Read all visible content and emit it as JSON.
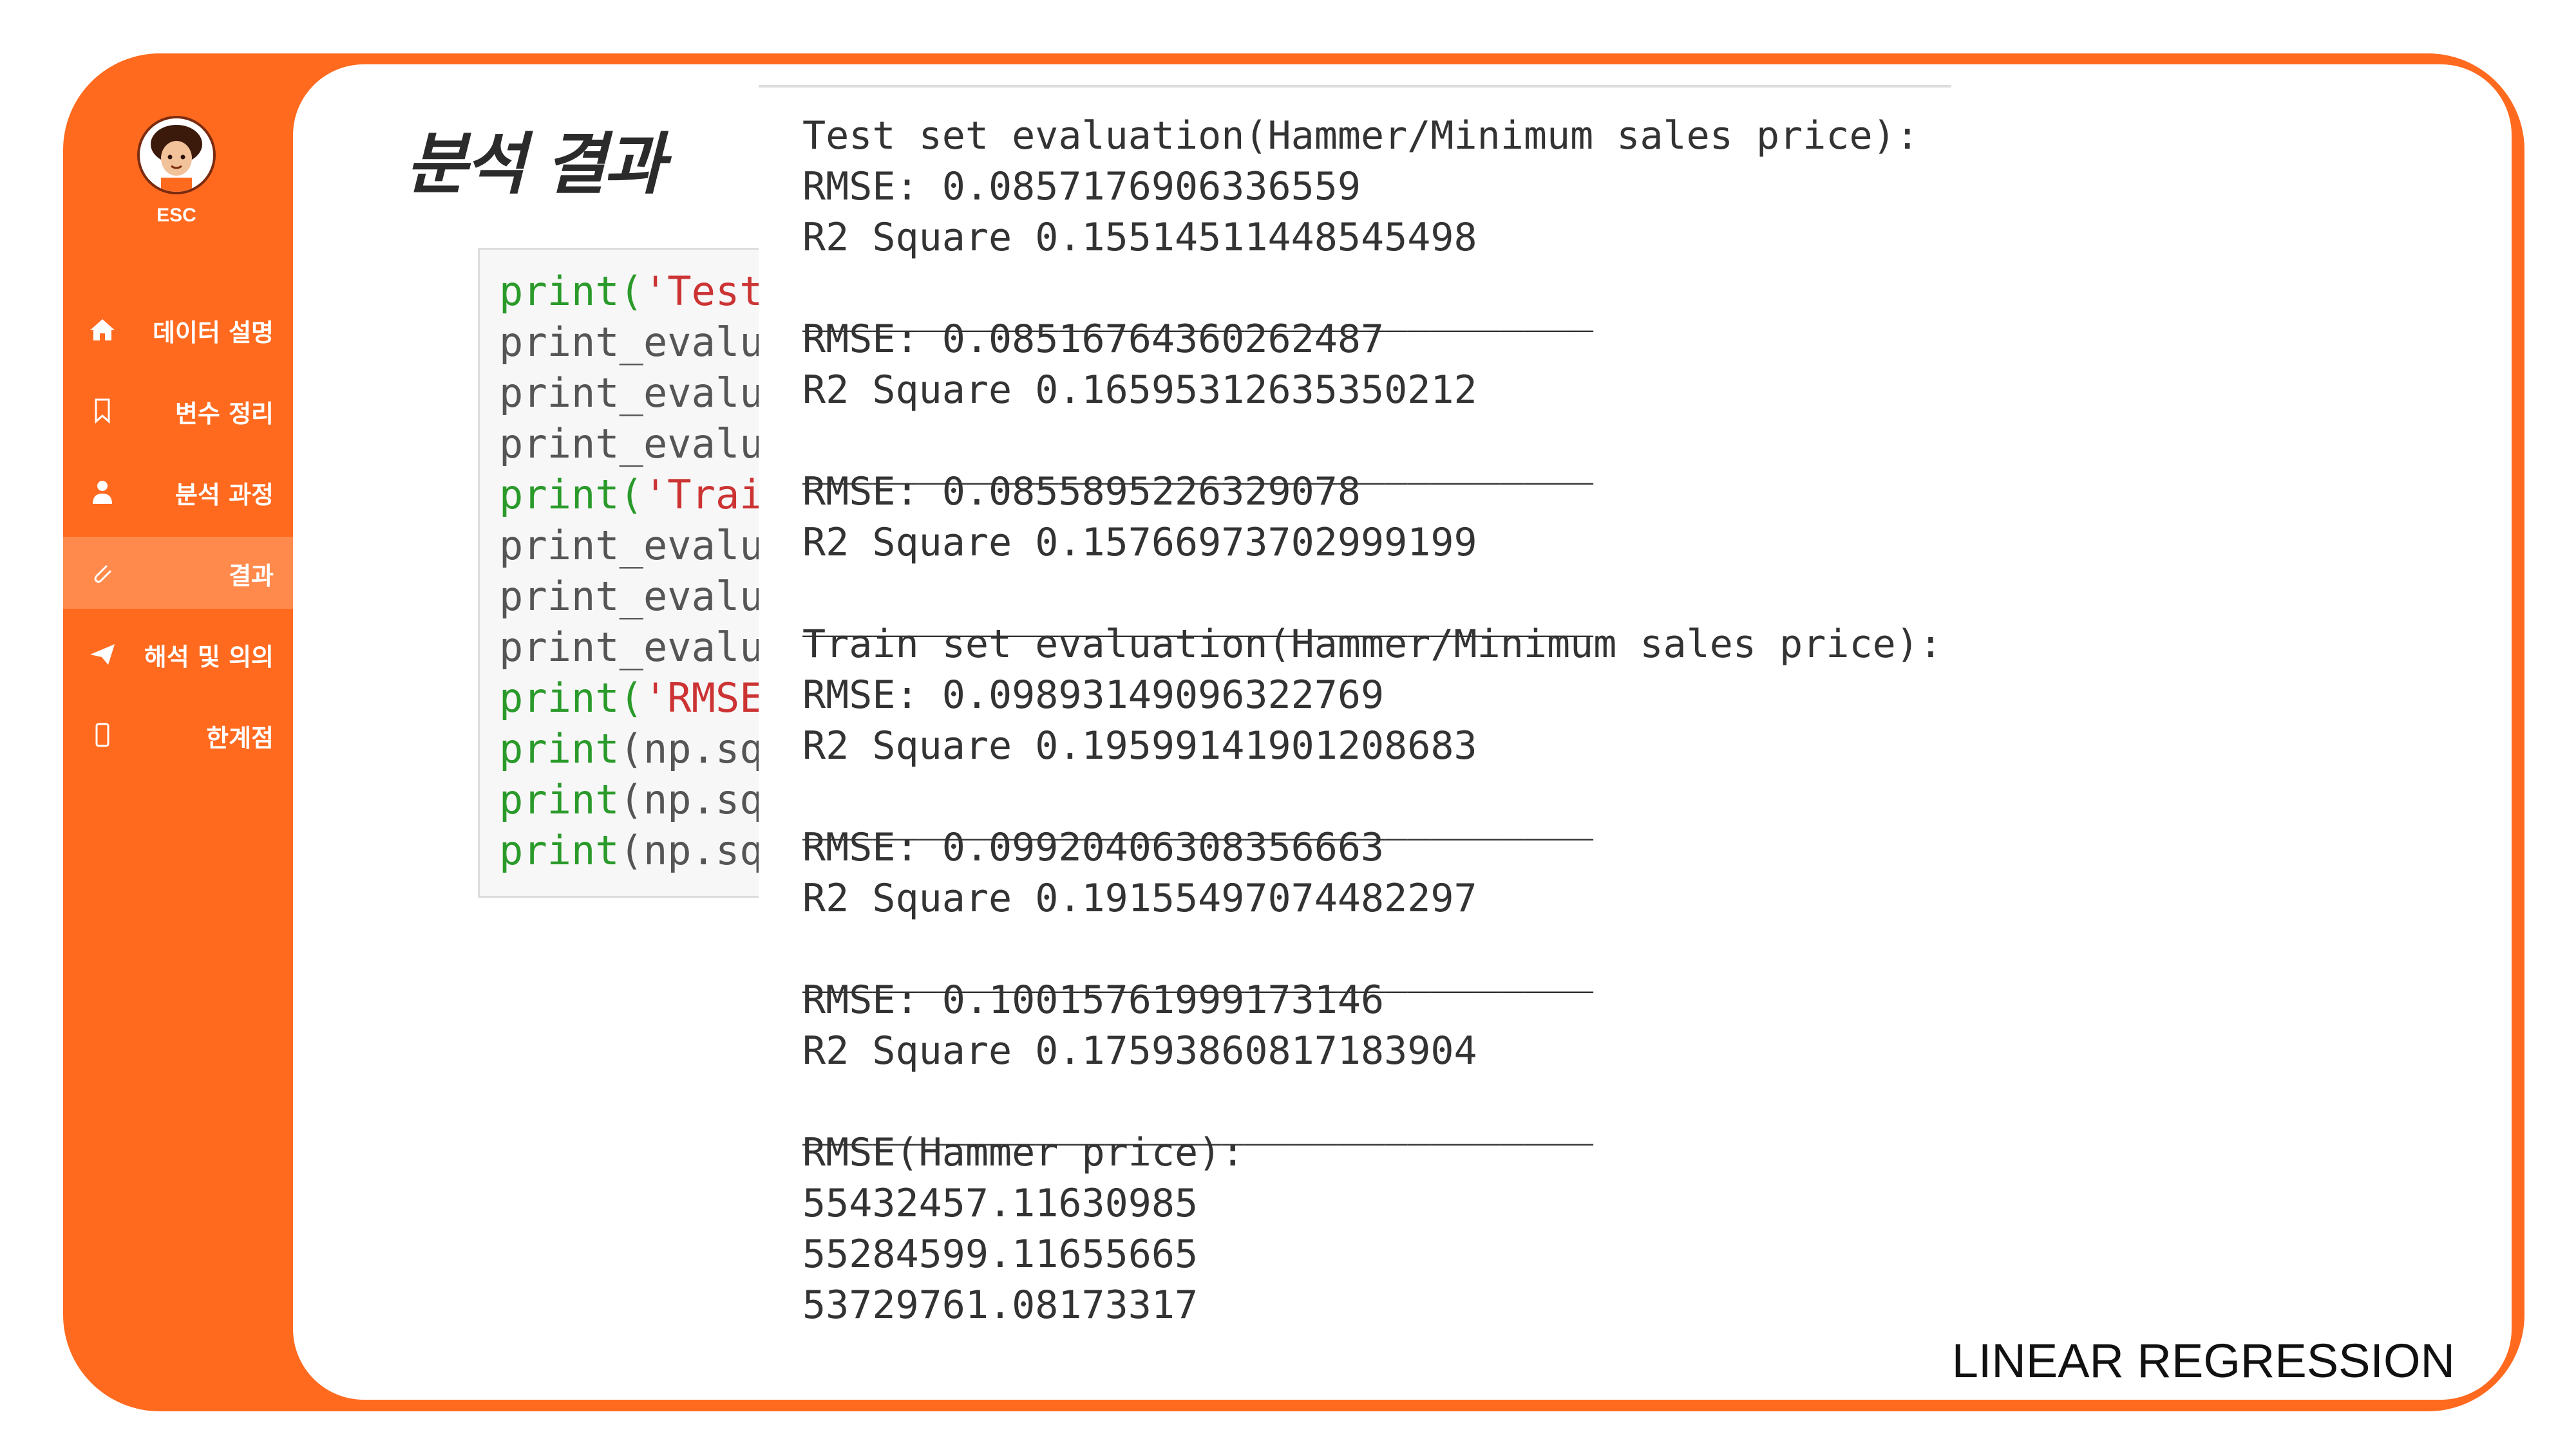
{
  "app": {
    "esc_label": "ESC"
  },
  "sidebar": {
    "items": [
      {
        "label": "데이터 설명",
        "icon": "home-icon",
        "active": false
      },
      {
        "label": "변수 정리",
        "icon": "bookmark-icon",
        "active": false
      },
      {
        "label": "분석 과정",
        "icon": "user-icon",
        "active": false
      },
      {
        "label": "결과",
        "icon": "paperclip-icon",
        "active": true
      },
      {
        "label": "해석 및 의의",
        "icon": "paper-plane-icon",
        "active": false
      },
      {
        "label": "한계점",
        "icon": "mobile-icon",
        "active": false
      }
    ]
  },
  "main": {
    "title": "분석 결과"
  },
  "code": {
    "lines": [
      {
        "fn": "print(",
        "rest": "'Test",
        "rest_type": "str"
      },
      {
        "fn": "",
        "rest": "print_evalua",
        "rest_type": "plain"
      },
      {
        "fn": "",
        "rest": "print_evalua",
        "rest_type": "plain"
      },
      {
        "fn": "",
        "rest": "print_evalua",
        "rest_type": "plain"
      },
      {
        "fn": "print(",
        "rest": "'Trair",
        "rest_type": "str"
      },
      {
        "fn": "",
        "rest": "print_evalua",
        "rest_type": "plain"
      },
      {
        "fn": "",
        "rest": "print_evalua",
        "rest_type": "plain"
      },
      {
        "fn": "",
        "rest": "print_evalua",
        "rest_type": "plain"
      },
      {
        "fn": "print(",
        "rest": "'RMSE(",
        "rest_type": "str"
      },
      {
        "fn": "print",
        "rest": "(np.sqr",
        "rest_type": "plain"
      },
      {
        "fn": "print",
        "rest": "(np.sqr",
        "rest_type": "plain"
      },
      {
        "fn": "print",
        "rest": "(np.sqr",
        "rest_type": "plain"
      }
    ]
  },
  "output": {
    "lines": [
      "Test set evaluation(Hammer/Minimum sales price):",
      "RMSE: 0.0857176906336559",
      "R2 Square 0.15514511448545498",
      "",
      "__________________________________",
      "RMSE: 0.08516764360262487",
      "R2 Square 0.16595312635350212",
      "",
      "__________________________________",
      "RMSE: 0.0855895226329078",
      "R2 Square 0.15766973702999199",
      "",
      "__________________________________",
      "Train set evaluation(Hammer/Minimum sales price):",
      "RMSE: 0.09893149096322769",
      "R2 Square 0.19599141901208683",
      "",
      "__________________________________",
      "RMSE: 0.09920406308356663",
      "R2 Square 0.19155497074482297",
      "",
      "__________________________________",
      "RMSE: 0.10015761999173146",
      "R2 Square 0.17593860817183904",
      "",
      "__________________________________",
      "RMSE(Hammer price):",
      "55432457.11630985",
      "55284599.11655665",
      "53729761.08173317"
    ]
  },
  "footer": {
    "text": "LINEAR REGRESSION"
  },
  "colors": {
    "brand": "#ff6a1f",
    "active": "#ff8a4c"
  }
}
